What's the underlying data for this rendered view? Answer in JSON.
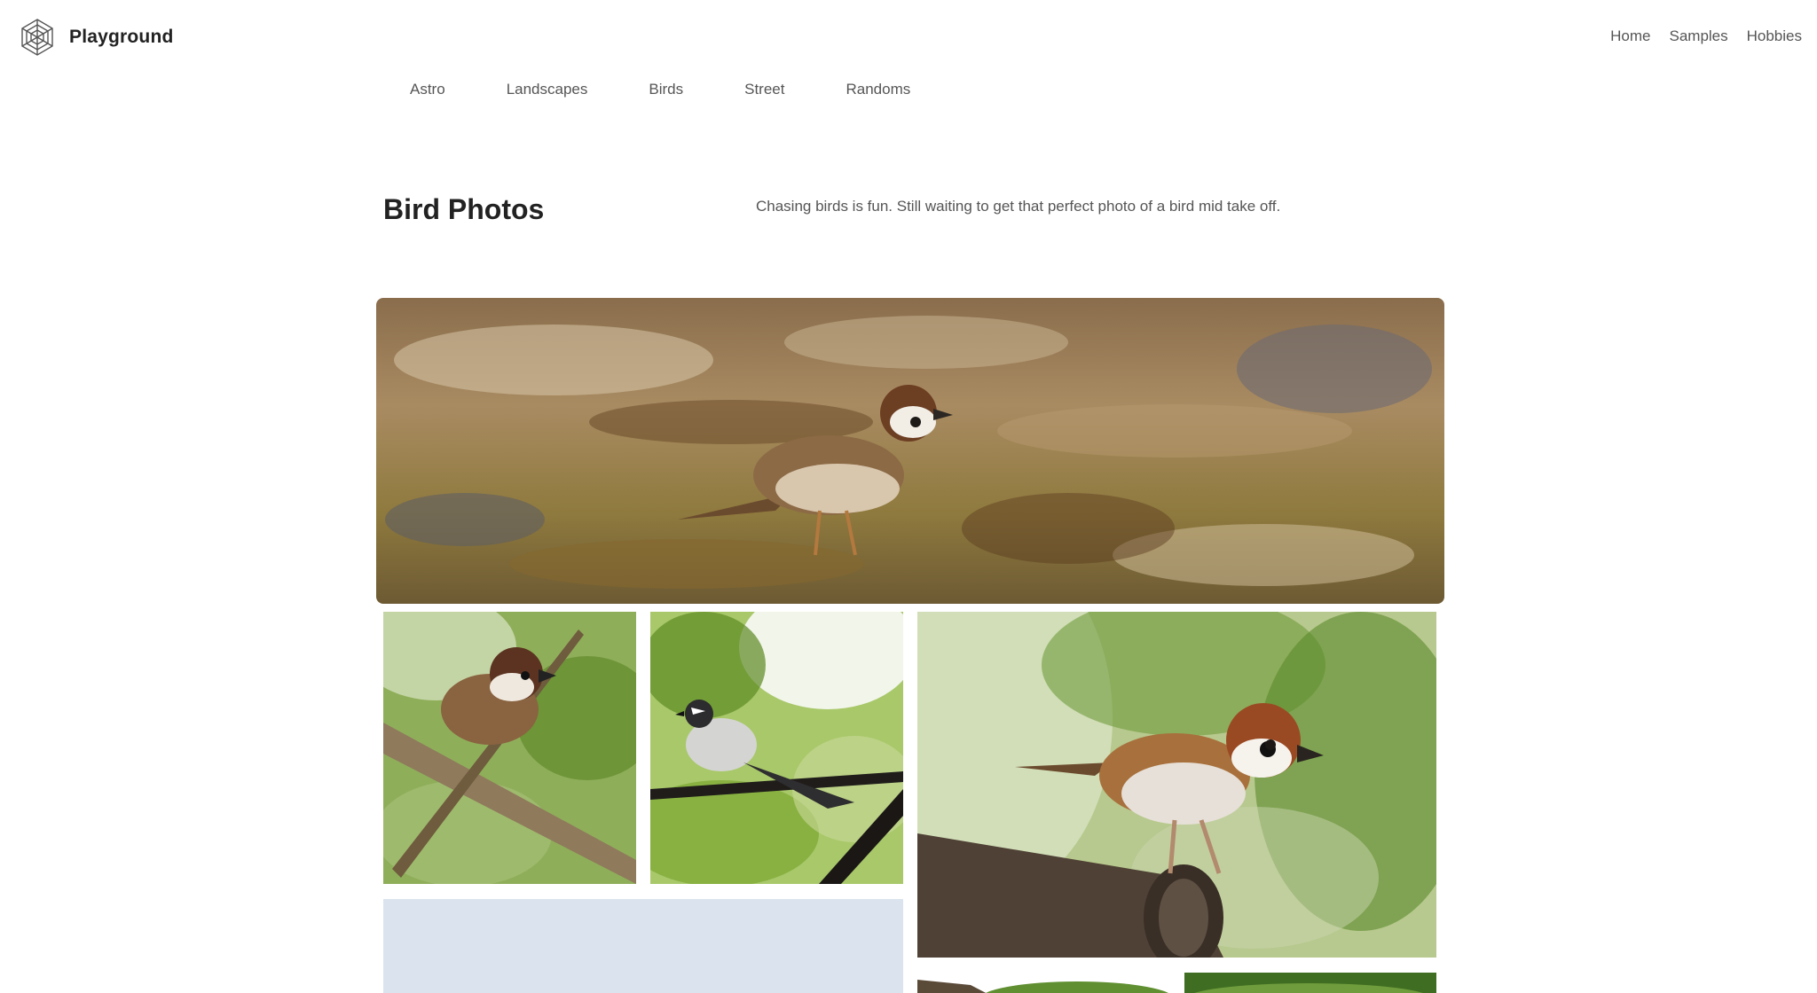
{
  "header": {
    "brand": "Playground",
    "nav": [
      "Home",
      "Samples",
      "Hobbies"
    ]
  },
  "subnav": [
    "Astro",
    "Landscapes",
    "Birds",
    "Street",
    "Randoms"
  ],
  "main": {
    "title": "Bird Photos",
    "description": "Chasing birds is fun. Still waiting to get that perfect photo of a bird mid take off."
  },
  "icons": {
    "logo": "hexagon-web-logo-icon"
  },
  "colors": {
    "text_dark": "#222222",
    "text_muted": "#555555",
    "background": "#ffffff"
  }
}
